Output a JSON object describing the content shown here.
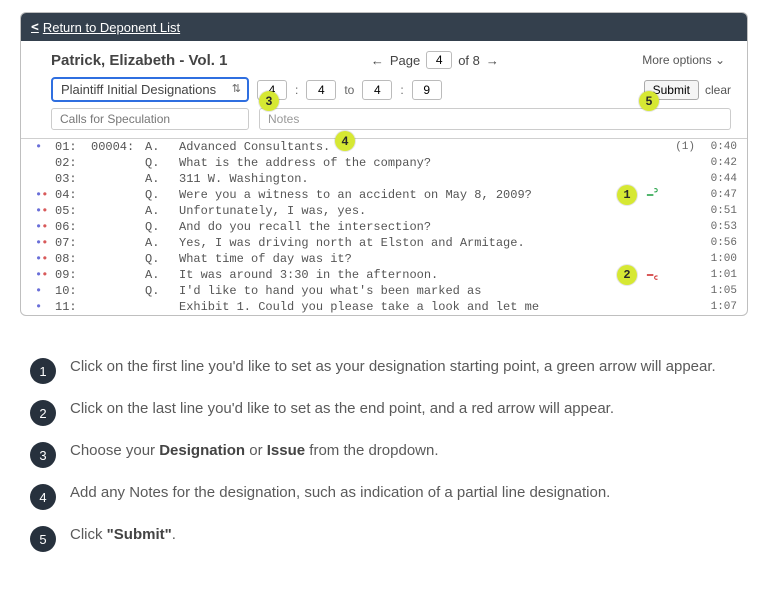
{
  "topbar": {
    "back": "Return to Deponent List"
  },
  "header": {
    "title": "Patrick, Elizabeth - Vol. 1",
    "page_label_pre": "Page",
    "page_current": "4",
    "page_label_of": "of 8",
    "more_options": "More options"
  },
  "controls": {
    "dropdown": "Plaintiff Initial Designations",
    "from_page": "4",
    "from_line": "4",
    "to_sep": "to",
    "to_page": "4",
    "to_line": "9",
    "submit": "Submit",
    "clear": "clear",
    "calls_placeholder": "Calls for Speculation",
    "notes_placeholder": "Notes"
  },
  "callouts": {
    "c1": "1",
    "c2": "2",
    "c3": "3",
    "c4": "4",
    "c5": "5"
  },
  "transcript": [
    {
      "dots_b": "•",
      "dots_r": "",
      "line": "01:",
      "page": "00004:",
      "sp": "A.",
      "txt": "Advanced Consultants.",
      "mk": "",
      "mkc": "",
      "cnt": "(1)",
      "time": "0:40"
    },
    {
      "dots_b": "",
      "dots_r": "",
      "line": "02:",
      "page": "",
      "sp": "Q.",
      "txt": "What is the address of the company?",
      "mk": "",
      "mkc": "",
      "cnt": "",
      "time": "0:42"
    },
    {
      "dots_b": "",
      "dots_r": "",
      "line": "03:",
      "page": "",
      "sp": "A.",
      "txt": "311 W. Washington.",
      "mk": "",
      "mkc": "",
      "cnt": "",
      "time": "0:44"
    },
    {
      "dots_b": "•",
      "dots_r": "•",
      "line": "04:",
      "page": "",
      "sp": "Q.",
      "txt": "Were you a witness to an accident on May 8, 2009?",
      "mk": "⎯꜄",
      "mkc": "mk-green",
      "cnt": "",
      "time": "0:47",
      "callout": "1"
    },
    {
      "dots_b": "•",
      "dots_r": "•",
      "line": "05:",
      "page": "",
      "sp": "A.",
      "txt": "Unfortunately, I was, yes.",
      "mk": "",
      "mkc": "",
      "cnt": "",
      "time": "0:51"
    },
    {
      "dots_b": "•",
      "dots_r": "•",
      "line": "06:",
      "page": "",
      "sp": "Q.",
      "txt": "And do you recall the intersection?",
      "mk": "",
      "mkc": "",
      "cnt": "",
      "time": "0:53"
    },
    {
      "dots_b": "•",
      "dots_r": "•",
      "line": "07:",
      "page": "",
      "sp": "A.",
      "txt": "Yes, I was driving north at Elston and Armitage.",
      "mk": "",
      "mkc": "",
      "cnt": "",
      "time": "0:56"
    },
    {
      "dots_b": "•",
      "dots_r": "•",
      "line": "08:",
      "page": "",
      "sp": "Q.",
      "txt": "What time of day was it?",
      "mk": "",
      "mkc": "",
      "cnt": "",
      "time": "1:00"
    },
    {
      "dots_b": "•",
      "dots_r": "•",
      "line": "09:",
      "page": "",
      "sp": "A.",
      "txt": "It was around 3:30 in the afternoon.",
      "mk": "⎯꜀",
      "mkc": "mk-red",
      "cnt": "",
      "time": "1:01",
      "callout": "2"
    },
    {
      "dots_b": "•",
      "dots_r": "",
      "line": "10:",
      "page": "",
      "sp": "Q.",
      "txt": "I'd like to hand you what's been marked as",
      "mk": "",
      "mkc": "",
      "cnt": "",
      "time": "1:05"
    },
    {
      "dots_b": "•",
      "dots_r": "",
      "line": "11:",
      "page": "",
      "sp": "",
      "txt": "Exhibit 1. Could you please take a look and let me",
      "mk": "",
      "mkc": "",
      "cnt": "",
      "time": "1:07"
    }
  ],
  "steps": [
    {
      "n": "1",
      "html": "Click on the first line you'd like to set as your designation starting point, a green arrow will appear."
    },
    {
      "n": "2",
      "html": "Click on the last line you'd like to set as the end point, and a red arrow will appear."
    },
    {
      "n": "3",
      "html": "Choose your <b>Designation</b> or <b>Issue</b> from the dropdown."
    },
    {
      "n": "4",
      "html": "Add any Notes for the designation, such as indication of a partial line designation."
    },
    {
      "n": "5",
      "html": "Click <b>\"Submit\"</b>."
    }
  ]
}
